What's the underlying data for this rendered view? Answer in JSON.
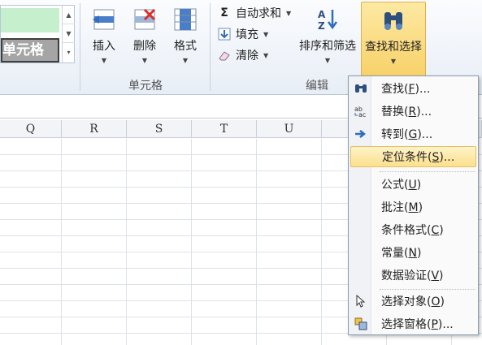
{
  "ribbon": {
    "styles": {
      "good_label": "",
      "check_cell_label": "单元格"
    },
    "cells_group": {
      "label": "单元格",
      "insert": "插入",
      "delete": "删除",
      "format": "格式"
    },
    "editing_group": {
      "label": "编辑",
      "autosum": "自动求和",
      "fill": "填充",
      "clear": "清除",
      "sort_filter": "排序和筛选",
      "find_select": "查找和选择"
    }
  },
  "grid": {
    "columns": [
      "Q",
      "R",
      "S",
      "T",
      "U"
    ]
  },
  "menu": {
    "items": [
      {
        "text": "查找(",
        "key": "F",
        "tail": ")...",
        "icon": "binoculars-icon"
      },
      {
        "text": "替换(",
        "key": "R",
        "tail": ")...",
        "icon": "replace-icon"
      },
      {
        "text": "转到(",
        "key": "G",
        "tail": ")...",
        "icon": "arrow-right-icon"
      },
      {
        "text": "定位条件(",
        "key": "S",
        "tail": ")...",
        "icon": "",
        "highlighted": true
      },
      {
        "text": "公式(",
        "key": "U",
        "tail": ")",
        "icon": ""
      },
      {
        "text": "批注(",
        "key": "M",
        "tail": ")",
        "icon": ""
      },
      {
        "text": "条件格式(",
        "key": "C",
        "tail": ")",
        "icon": ""
      },
      {
        "text": "常量(",
        "key": "N",
        "tail": ")",
        "icon": ""
      },
      {
        "text": "数据验证(",
        "key": "V",
        "tail": ")",
        "icon": ""
      },
      {
        "text": "选择对象(",
        "key": "O",
        "tail": ")",
        "icon": "cursor-icon"
      },
      {
        "text": "选择窗格(",
        "key": "P",
        "tail": ")...",
        "icon": "selection-pane-icon"
      }
    ]
  },
  "colors": {
    "highlight": "#fbe08d",
    "ribbon_bg": "#e8eef6",
    "good_style": "#c6efce",
    "check_cell_style": "#a5a5a5"
  }
}
